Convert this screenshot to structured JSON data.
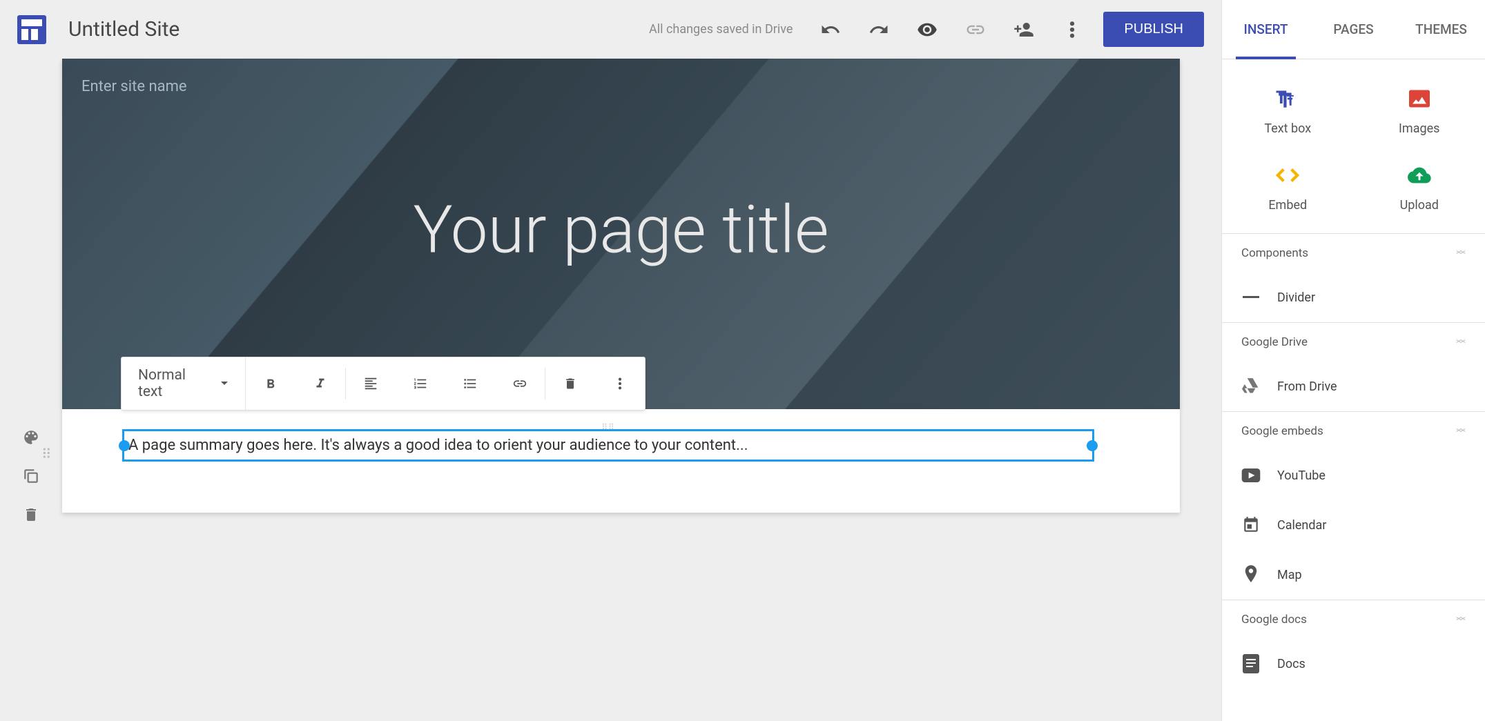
{
  "header": {
    "siteTitle": "Untitled Site",
    "saveStatus": "All changes saved in Drive",
    "publishLabel": "PUBLISH"
  },
  "canvas": {
    "siteNamePlaceholder": "Enter site name",
    "pageTitle": "Your page title",
    "summaryText": "A page summary goes here. It's always a good idea to orient your audience to your content..."
  },
  "toolbar": {
    "styleLabel": "Normal text"
  },
  "tabs": [
    "INSERT",
    "PAGES",
    "THEMES"
  ],
  "insertItems": [
    {
      "label": "Text box"
    },
    {
      "label": "Images"
    },
    {
      "label": "Embed"
    },
    {
      "label": "Upload"
    }
  ],
  "sections": {
    "components": {
      "title": "Components",
      "items": [
        "Divider"
      ]
    },
    "drive": {
      "title": "Google Drive",
      "items": [
        "From Drive"
      ]
    },
    "embeds": {
      "title": "Google embeds",
      "items": [
        "YouTube",
        "Calendar",
        "Map"
      ]
    },
    "docs": {
      "title": "Google docs",
      "items": [
        "Docs"
      ]
    }
  }
}
